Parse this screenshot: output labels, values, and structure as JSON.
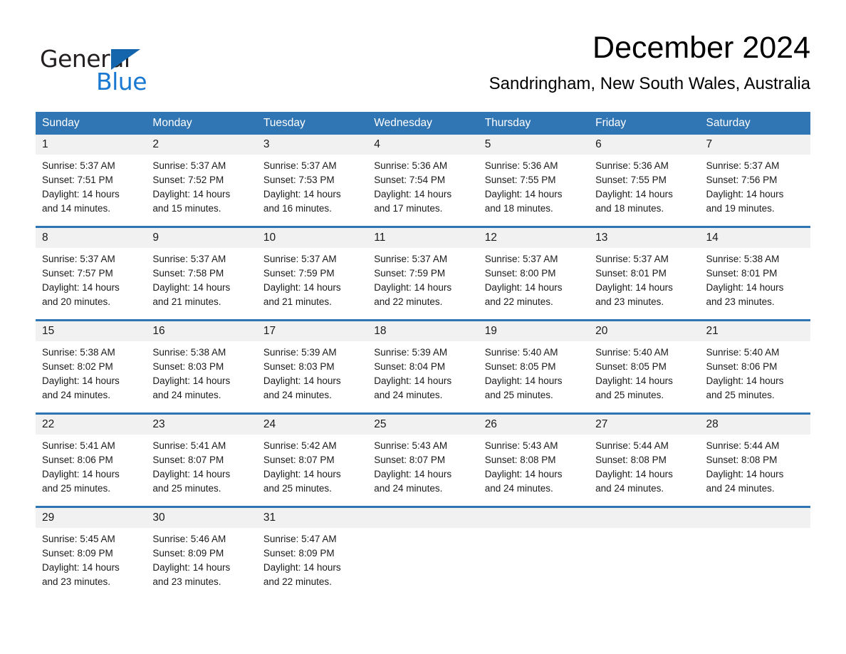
{
  "brand": {
    "word_one": "General",
    "word_two": "Blue",
    "triangle_icon": "brand-triangle-icon",
    "accent_blue": "#1978d2",
    "triangle_blue": "#1565ac",
    "dark_text": "#231f20"
  },
  "header": {
    "title": "December 2024",
    "location": "Sandringham, New South Wales, Australia"
  },
  "theme": {
    "header_blue": "#3075b4",
    "week_rule_blue": "#2f74b3",
    "daynum_band": "#f1f1f1",
    "page_background": "#ffffff"
  },
  "weekday_headers": [
    "Sunday",
    "Monday",
    "Tuesday",
    "Wednesday",
    "Thursday",
    "Friday",
    "Saturday"
  ],
  "weeks": [
    [
      {
        "day": "1",
        "sunrise": "Sunrise: 5:37 AM",
        "sunset": "Sunset: 7:51 PM",
        "daylight_1": "Daylight: 14 hours",
        "daylight_2": "and 14 minutes."
      },
      {
        "day": "2",
        "sunrise": "Sunrise: 5:37 AM",
        "sunset": "Sunset: 7:52 PM",
        "daylight_1": "Daylight: 14 hours",
        "daylight_2": "and 15 minutes."
      },
      {
        "day": "3",
        "sunrise": "Sunrise: 5:37 AM",
        "sunset": "Sunset: 7:53 PM",
        "daylight_1": "Daylight: 14 hours",
        "daylight_2": "and 16 minutes."
      },
      {
        "day": "4",
        "sunrise": "Sunrise: 5:36 AM",
        "sunset": "Sunset: 7:54 PM",
        "daylight_1": "Daylight: 14 hours",
        "daylight_2": "and 17 minutes."
      },
      {
        "day": "5",
        "sunrise": "Sunrise: 5:36 AM",
        "sunset": "Sunset: 7:55 PM",
        "daylight_1": "Daylight: 14 hours",
        "daylight_2": "and 18 minutes."
      },
      {
        "day": "6",
        "sunrise": "Sunrise: 5:36 AM",
        "sunset": "Sunset: 7:55 PM",
        "daylight_1": "Daylight: 14 hours",
        "daylight_2": "and 18 minutes."
      },
      {
        "day": "7",
        "sunrise": "Sunrise: 5:37 AM",
        "sunset": "Sunset: 7:56 PM",
        "daylight_1": "Daylight: 14 hours",
        "daylight_2": "and 19 minutes."
      }
    ],
    [
      {
        "day": "8",
        "sunrise": "Sunrise: 5:37 AM",
        "sunset": "Sunset: 7:57 PM",
        "daylight_1": "Daylight: 14 hours",
        "daylight_2": "and 20 minutes."
      },
      {
        "day": "9",
        "sunrise": "Sunrise: 5:37 AM",
        "sunset": "Sunset: 7:58 PM",
        "daylight_1": "Daylight: 14 hours",
        "daylight_2": "and 21 minutes."
      },
      {
        "day": "10",
        "sunrise": "Sunrise: 5:37 AM",
        "sunset": "Sunset: 7:59 PM",
        "daylight_1": "Daylight: 14 hours",
        "daylight_2": "and 21 minutes."
      },
      {
        "day": "11",
        "sunrise": "Sunrise: 5:37 AM",
        "sunset": "Sunset: 7:59 PM",
        "daylight_1": "Daylight: 14 hours",
        "daylight_2": "and 22 minutes."
      },
      {
        "day": "12",
        "sunrise": "Sunrise: 5:37 AM",
        "sunset": "Sunset: 8:00 PM",
        "daylight_1": "Daylight: 14 hours",
        "daylight_2": "and 22 minutes."
      },
      {
        "day": "13",
        "sunrise": "Sunrise: 5:37 AM",
        "sunset": "Sunset: 8:01 PM",
        "daylight_1": "Daylight: 14 hours",
        "daylight_2": "and 23 minutes."
      },
      {
        "day": "14",
        "sunrise": "Sunrise: 5:38 AM",
        "sunset": "Sunset: 8:01 PM",
        "daylight_1": "Daylight: 14 hours",
        "daylight_2": "and 23 minutes."
      }
    ],
    [
      {
        "day": "15",
        "sunrise": "Sunrise: 5:38 AM",
        "sunset": "Sunset: 8:02 PM",
        "daylight_1": "Daylight: 14 hours",
        "daylight_2": "and 24 minutes."
      },
      {
        "day": "16",
        "sunrise": "Sunrise: 5:38 AM",
        "sunset": "Sunset: 8:03 PM",
        "daylight_1": "Daylight: 14 hours",
        "daylight_2": "and 24 minutes."
      },
      {
        "day": "17",
        "sunrise": "Sunrise: 5:39 AM",
        "sunset": "Sunset: 8:03 PM",
        "daylight_1": "Daylight: 14 hours",
        "daylight_2": "and 24 minutes."
      },
      {
        "day": "18",
        "sunrise": "Sunrise: 5:39 AM",
        "sunset": "Sunset: 8:04 PM",
        "daylight_1": "Daylight: 14 hours",
        "daylight_2": "and 24 minutes."
      },
      {
        "day": "19",
        "sunrise": "Sunrise: 5:40 AM",
        "sunset": "Sunset: 8:05 PM",
        "daylight_1": "Daylight: 14 hours",
        "daylight_2": "and 25 minutes."
      },
      {
        "day": "20",
        "sunrise": "Sunrise: 5:40 AM",
        "sunset": "Sunset: 8:05 PM",
        "daylight_1": "Daylight: 14 hours",
        "daylight_2": "and 25 minutes."
      },
      {
        "day": "21",
        "sunrise": "Sunrise: 5:40 AM",
        "sunset": "Sunset: 8:06 PM",
        "daylight_1": "Daylight: 14 hours",
        "daylight_2": "and 25 minutes."
      }
    ],
    [
      {
        "day": "22",
        "sunrise": "Sunrise: 5:41 AM",
        "sunset": "Sunset: 8:06 PM",
        "daylight_1": "Daylight: 14 hours",
        "daylight_2": "and 25 minutes."
      },
      {
        "day": "23",
        "sunrise": "Sunrise: 5:41 AM",
        "sunset": "Sunset: 8:07 PM",
        "daylight_1": "Daylight: 14 hours",
        "daylight_2": "and 25 minutes."
      },
      {
        "day": "24",
        "sunrise": "Sunrise: 5:42 AM",
        "sunset": "Sunset: 8:07 PM",
        "daylight_1": "Daylight: 14 hours",
        "daylight_2": "and 25 minutes."
      },
      {
        "day": "25",
        "sunrise": "Sunrise: 5:43 AM",
        "sunset": "Sunset: 8:07 PM",
        "daylight_1": "Daylight: 14 hours",
        "daylight_2": "and 24 minutes."
      },
      {
        "day": "26",
        "sunrise": "Sunrise: 5:43 AM",
        "sunset": "Sunset: 8:08 PM",
        "daylight_1": "Daylight: 14 hours",
        "daylight_2": "and 24 minutes."
      },
      {
        "day": "27",
        "sunrise": "Sunrise: 5:44 AM",
        "sunset": "Sunset: 8:08 PM",
        "daylight_1": "Daylight: 14 hours",
        "daylight_2": "and 24 minutes."
      },
      {
        "day": "28",
        "sunrise": "Sunrise: 5:44 AM",
        "sunset": "Sunset: 8:08 PM",
        "daylight_1": "Daylight: 14 hours",
        "daylight_2": "and 24 minutes."
      }
    ],
    [
      {
        "day": "29",
        "sunrise": "Sunrise: 5:45 AM",
        "sunset": "Sunset: 8:09 PM",
        "daylight_1": "Daylight: 14 hours",
        "daylight_2": "and 23 minutes."
      },
      {
        "day": "30",
        "sunrise": "Sunrise: 5:46 AM",
        "sunset": "Sunset: 8:09 PM",
        "daylight_1": "Daylight: 14 hours",
        "daylight_2": "and 23 minutes."
      },
      {
        "day": "31",
        "sunrise": "Sunrise: 5:47 AM",
        "sunset": "Sunset: 8:09 PM",
        "daylight_1": "Daylight: 14 hours",
        "daylight_2": "and 22 minutes."
      },
      null,
      null,
      null,
      null
    ]
  ]
}
